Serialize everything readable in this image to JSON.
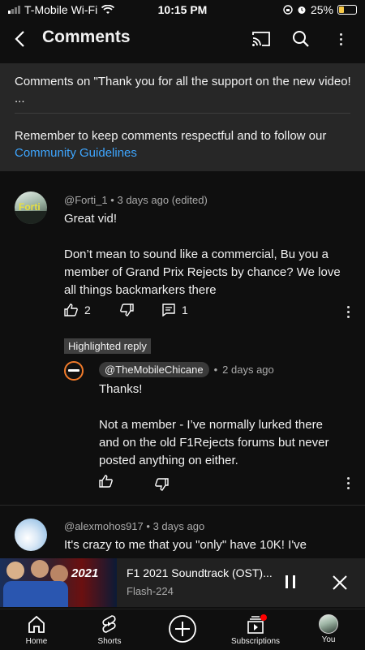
{
  "status_bar": {
    "carrier": "T-Mobile Wi-Fi",
    "time": "10:15 PM",
    "battery": "25%",
    "battery_level": 0.25
  },
  "header": {
    "title": "Comments",
    "back_icon": "back-arrow-icon",
    "cast_icon": "cast-icon",
    "search_icon": "search-icon",
    "more_icon": "more-vertical-icon"
  },
  "banner": {
    "video_line": "Comments on \"Thank you for all the support on the new video! ...",
    "guidelines_text": "Remember to keep comments respectful and to follow our",
    "guidelines_link": "Community Guidelines"
  },
  "comments": [
    {
      "author": "@Forti_1",
      "time": "3 days ago (edited)",
      "avatar_text": "Forti",
      "text": "Great vid!\n\nDon’t mean to sound like a commercial, Bu you a member of Grand Prix Rejects by chance? We love all things backmarkers there",
      "likes": "2",
      "replies": "1"
    },
    {
      "highlight_label": "Highlighted reply",
      "author": "@TheMobileChicane",
      "time": "2 days ago",
      "text": "Thanks!\n\nNot a member - I’ve normally lurked there and on the old F1Rejects forums but never posted anything on either."
    },
    {
      "author": "@alexmohos917",
      "time": "3 days ago",
      "text": "It's crazy to me that you \"only\" have 10K! I've"
    }
  ],
  "separator": "•",
  "mini_player": {
    "title": "F1 2021 Soundtrack (OST)...",
    "channel": "Flash-224",
    "thumb_text": "2021",
    "pause_icon": "pause-icon",
    "close_icon": "close-icon"
  },
  "nav": {
    "items": [
      {
        "label": "Home",
        "icon": "home-icon"
      },
      {
        "label": "Shorts",
        "icon": "shorts-icon"
      },
      {
        "label": "",
        "icon": "create-plus-icon"
      },
      {
        "label": "Subscriptions",
        "icon": "subscriptions-icon"
      },
      {
        "label": "You",
        "icon": "profile-avatar-icon"
      }
    ]
  },
  "colors": {
    "background": "#0f0f0f",
    "banner": "#272727",
    "link": "#3ea6ff",
    "chicane_ring": "#f07a2a",
    "notification_dot": "#ff0000"
  }
}
